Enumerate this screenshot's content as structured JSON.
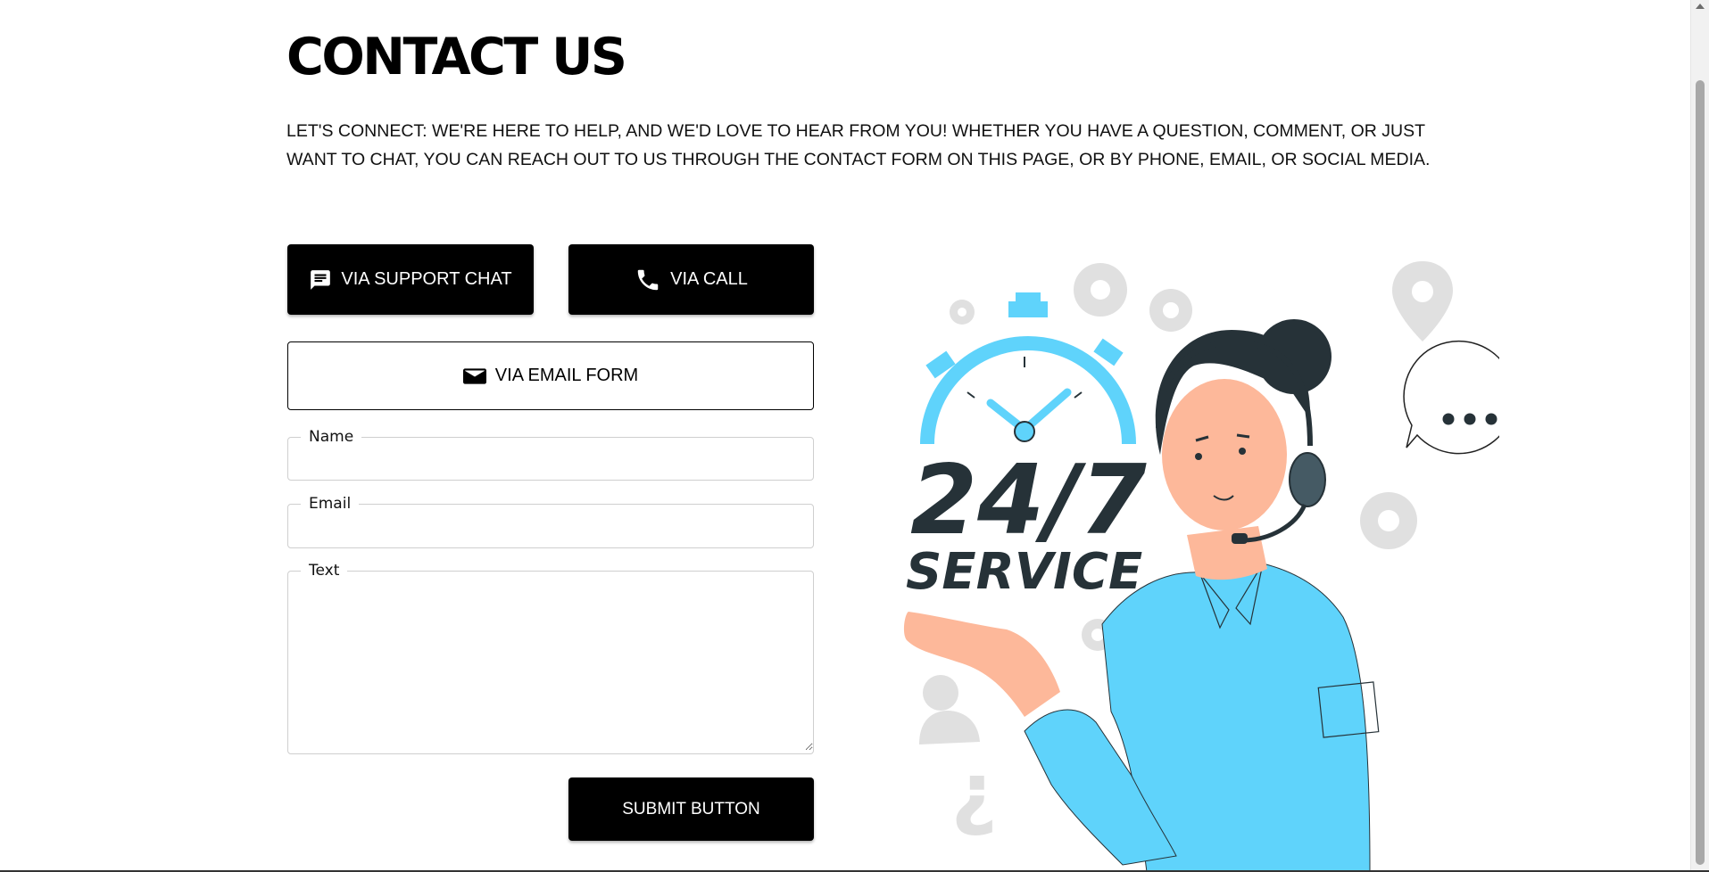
{
  "header": {
    "title": "CONTACT US",
    "intro": "LET'S CONNECT: WE'RE HERE TO HELP, AND WE'D LOVE TO HEAR FROM YOU! WHETHER YOU HAVE A QUESTION, COMMENT, OR JUST WANT TO CHAT, YOU CAN REACH OUT TO US THROUGH THE CONTACT FORM ON THIS PAGE, OR BY PHONE, EMAIL, OR SOCIAL MEDIA."
  },
  "contact_methods": {
    "chat": {
      "label": "VIA SUPPORT CHAT",
      "icon": "chat-icon"
    },
    "call": {
      "label": "VIA CALL",
      "icon": "phone-icon"
    },
    "email": {
      "label": "VIA EMAIL FORM",
      "icon": "mail-icon"
    }
  },
  "form": {
    "name_label": "Name",
    "name_value": "",
    "email_label": "Email",
    "email_value": "",
    "text_label": "Text",
    "text_value": "",
    "submit_label": "SUBMIT BUTTON"
  },
  "illustration": {
    "headline": "24/7",
    "subline": "SERVICE"
  },
  "colors": {
    "accent": "#5fd3fb",
    "dark": "#263238",
    "skin": "#fdb89a"
  }
}
